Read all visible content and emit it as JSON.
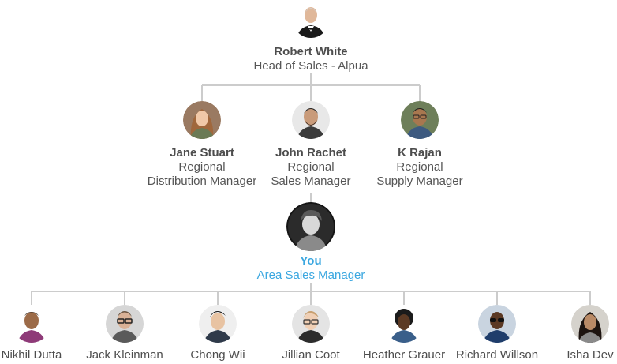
{
  "root": {
    "name": "Robert White",
    "title": "Head of Sales - Alpua",
    "avatar_icon": "person-avatar-icon"
  },
  "managers": [
    {
      "name": "Jane Stuart",
      "title_line1": "Regional",
      "title_line2": "Distribution Manager",
      "avatar_icon": "person-avatar-icon"
    },
    {
      "name": "John Rachet",
      "title_line1": "Regional",
      "title_line2": "Sales Manager",
      "avatar_icon": "person-avatar-icon"
    },
    {
      "name": "K Rajan",
      "title_line1": "Regional",
      "title_line2": "Supply Manager",
      "avatar_icon": "person-avatar-icon"
    }
  ],
  "you": {
    "name": "You",
    "title": "Area Sales Manager",
    "accent_color": "#3aa7e0",
    "avatar_icon": "person-avatar-icon"
  },
  "reports": [
    {
      "name": "Nikhil Dutta"
    },
    {
      "name": "Jack Kleinman"
    },
    {
      "name": "Chong Wii"
    },
    {
      "name": "Jillian Coot"
    },
    {
      "name": "Heather Grauer"
    },
    {
      "name": "Richard Willson"
    },
    {
      "name": "Isha Dev"
    }
  ],
  "colors": {
    "connector": "#cccccc",
    "text": "#4d4d4d",
    "accent": "#3aa7e0"
  }
}
